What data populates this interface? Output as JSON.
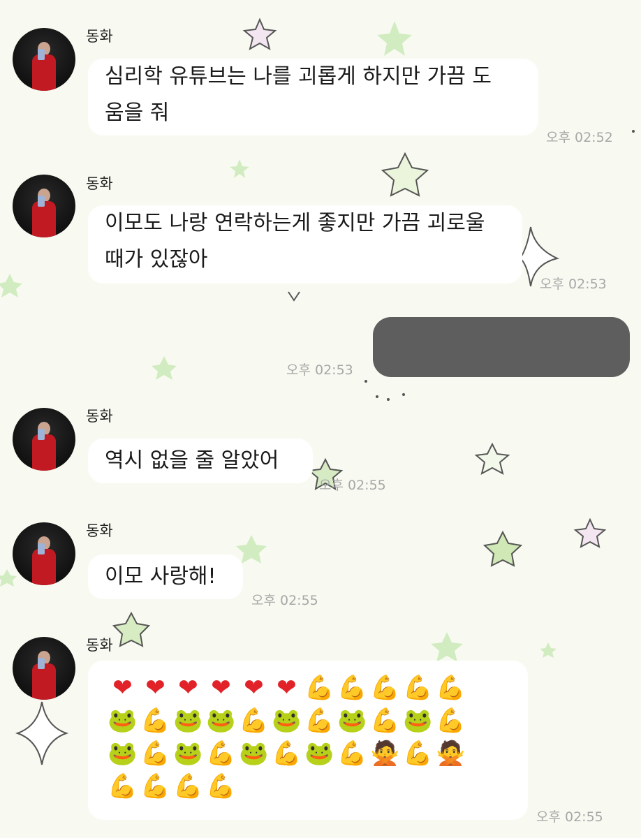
{
  "messages": [
    {
      "sender": "동화",
      "text": "심리학 유튜브는 나를 괴롭게 하지만 가끔 도움을 줘",
      "line1": "심리학 유튜브는 나를 괴롭게 하지만 가끔 도",
      "line2": "움을 줘",
      "time": "오후 02:52"
    },
    {
      "sender": "동화",
      "text": "이모도 나랑 연락하는게 좋지만 가끔 괴로울 때가 있잖아",
      "line1": "이모도 나랑 연락하는게 좋지만 가끔 괴로울",
      "line2": "때가 있잖아",
      "time": "오후 02:53"
    },
    {
      "sender": "me",
      "text": "",
      "time": "오후 02:53",
      "redacted": true
    },
    {
      "sender": "동화",
      "text": "역시 없을 줄 알았어",
      "time": "오후 02:55"
    },
    {
      "sender": "동화",
      "text": "이모 사랑해!",
      "time": "오후 02:55"
    },
    {
      "sender": "동화",
      "emoji": [
        "❤",
        "❤",
        "❤",
        "❤",
        "❤",
        "❤",
        "💪",
        "💪",
        "💪",
        "💪",
        "💪",
        "🐸",
        "💪",
        "🐸",
        "🐸",
        "💪",
        "🐸",
        "💪",
        "🐸",
        "💪",
        "🐸",
        "💪",
        "🐸",
        "💪",
        "🐸",
        "💪",
        "🐸",
        "💪",
        "🐸",
        "💪",
        "🙅",
        "💪",
        "🙅",
        "💪",
        "💪",
        "💪",
        "💪"
      ],
      "time": "오후 02:55"
    }
  ],
  "colors": {
    "background": "#f8faf1",
    "bubble": "#ffffff",
    "redacted": "#5e5e5e",
    "timestamp": "#a7a7a7"
  }
}
